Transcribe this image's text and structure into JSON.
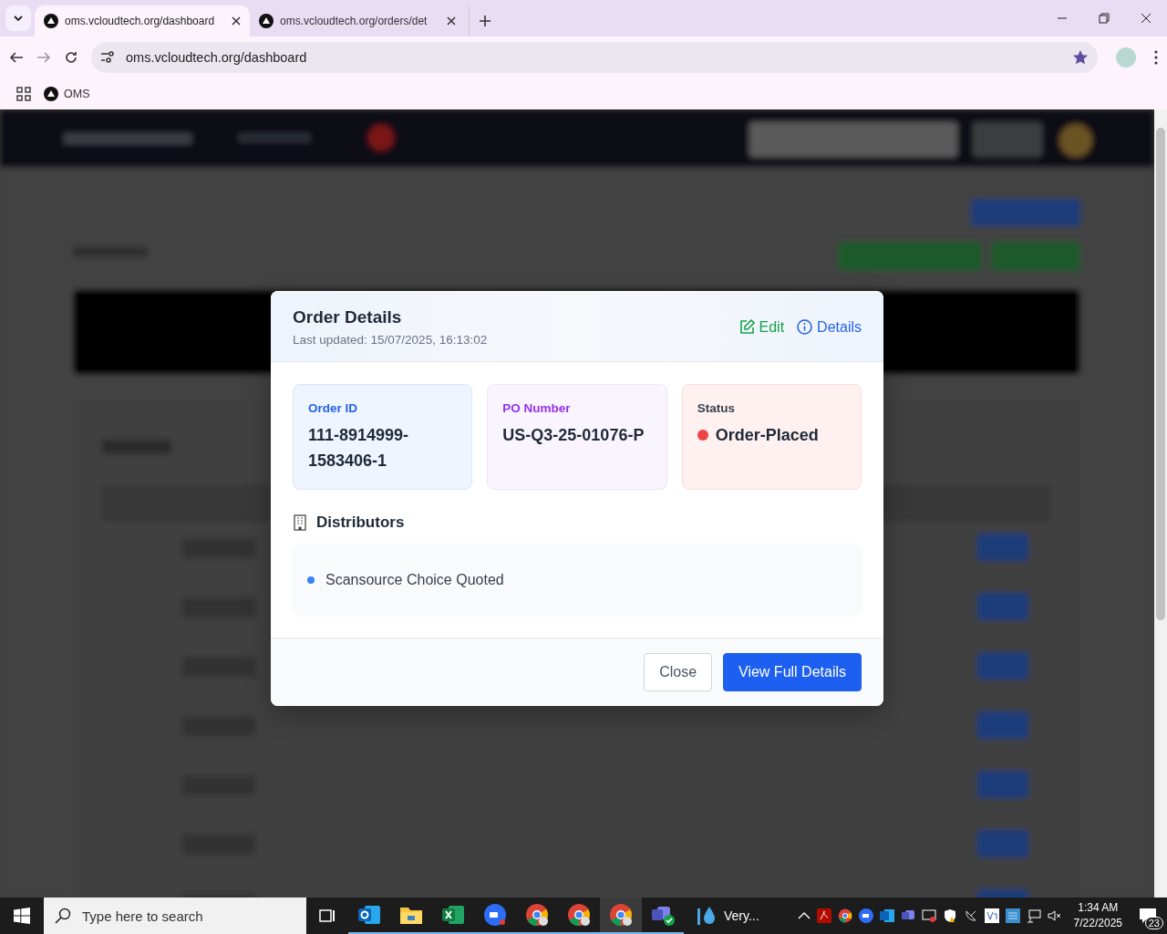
{
  "browser": {
    "tabs": [
      {
        "title": "oms.vcloudtech.org/dashboard",
        "selected": true
      },
      {
        "title": "oms.vcloudtech.org/orders/det",
        "selected": false
      }
    ],
    "address": "oms.vcloudtech.org/dashboard",
    "bookmarked": true,
    "bookmarks": [
      {
        "label": "OMS"
      }
    ]
  },
  "modal": {
    "title": "Order Details",
    "subtitle": "Last updated: 15/07/2025, 16:13:02",
    "actions": [
      {
        "kind": "edit",
        "label": "Edit"
      },
      {
        "kind": "info",
        "label": "Details"
      }
    ],
    "cards": [
      {
        "kind": "order",
        "label": "Order ID",
        "value": "111-8914999-1583406-1"
      },
      {
        "kind": "po",
        "label": "PO Number",
        "value": "US-Q3-25-01076-P"
      },
      {
        "kind": "status",
        "label": "Status",
        "value": "Order-Placed",
        "color": "#ef4444"
      }
    ],
    "distributors_title": "Distributors",
    "distributors": [
      {
        "name": "Scansource Choice Quoted",
        "color": "#3b82f6"
      }
    ],
    "buttons": [
      {
        "kind": "secondary",
        "label": "Close"
      },
      {
        "kind": "primary",
        "label": "View Full Details"
      }
    ]
  },
  "taskbar": {
    "search_placeholder": "Type here to search",
    "apps": [
      {
        "kind": "taskview",
        "selected": false
      },
      {
        "kind": "outlook",
        "selected": false
      },
      {
        "kind": "explorer",
        "selected": false
      },
      {
        "kind": "excel",
        "selected": false
      },
      {
        "kind": "zoom",
        "selected": false
      },
      {
        "kind": "chrome",
        "selected": false
      },
      {
        "kind": "chrome",
        "selected": false
      },
      {
        "kind": "chrome",
        "selected": true
      },
      {
        "kind": "teams",
        "selected": false
      }
    ],
    "weather": "Very...",
    "time": "1:34 AM",
    "date": "7/22/2025",
    "notifications": "23"
  }
}
